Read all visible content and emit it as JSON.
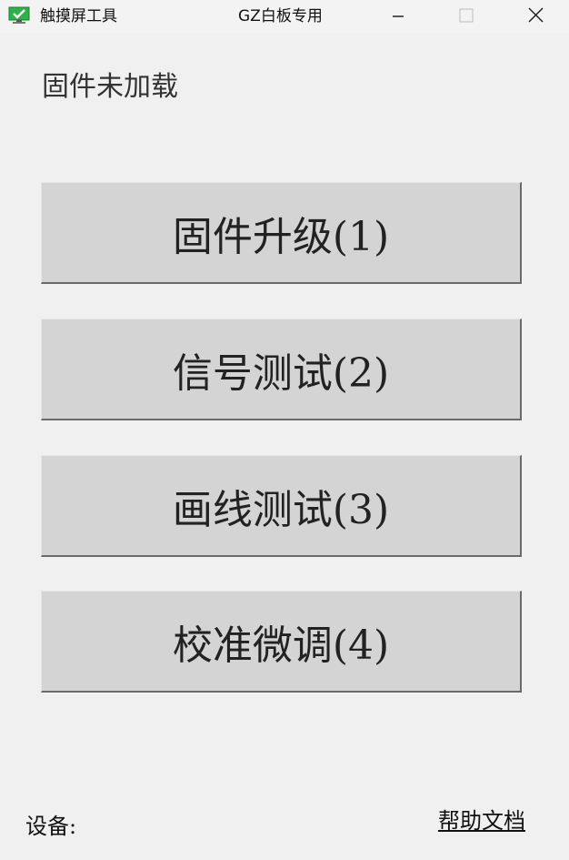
{
  "window": {
    "app_name": "触摸屏工具",
    "title": "GZ白板专用",
    "icon": "monitor-check-icon",
    "controls": {
      "minimize_icon": "minimize-icon",
      "maximize_icon": "maximize-icon",
      "close_icon": "close-icon"
    }
  },
  "main": {
    "status": "固件未加载",
    "buttons": [
      {
        "label": "固件升级(1)"
      },
      {
        "label": "信号测试(2)"
      },
      {
        "label": "画线测试(3)"
      },
      {
        "label": "校准微调(4)"
      }
    ]
  },
  "footer": {
    "device_label": "设备:",
    "help_link": "帮助文档"
  },
  "colors": {
    "background": "#f0f0f0",
    "button_face": "#d4d4d4",
    "icon_green": "#2bb34a"
  }
}
